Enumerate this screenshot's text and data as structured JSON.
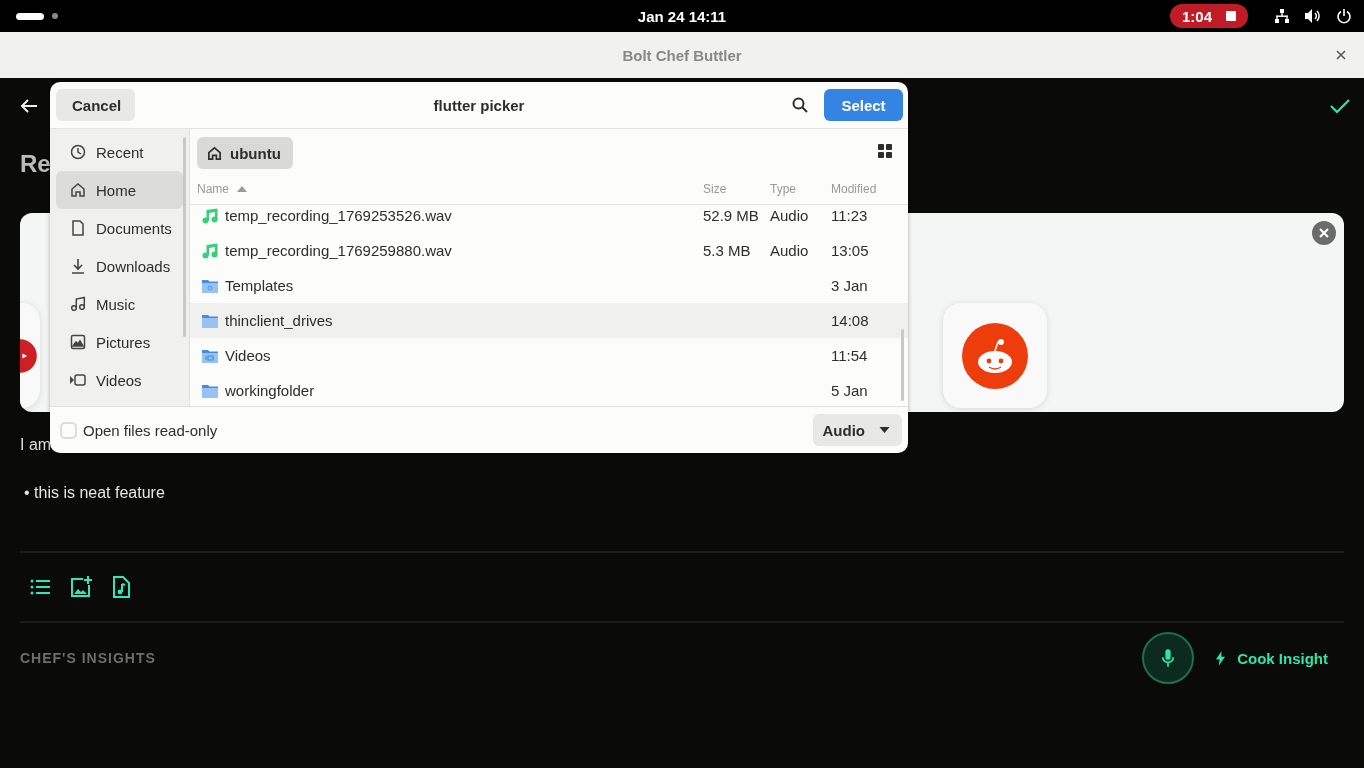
{
  "top_bar": {
    "clock": "Jan 24  14:11",
    "recording": "1:04"
  },
  "app": {
    "title": "Bolt Chef Buttler",
    "heading": "Re",
    "body_text": "I am",
    "bullet": "• this is neat feature",
    "section_title": "CHEF'S INSIGHTS",
    "insight_button": "Cook Insight"
  },
  "dialog": {
    "cancel": "Cancel",
    "title": "flutter picker",
    "select": "Select",
    "path": "ubuntu",
    "sidebar": [
      {
        "label": "Recent",
        "kind": "recent",
        "selected": false
      },
      {
        "label": "Home",
        "kind": "home",
        "selected": true
      },
      {
        "label": "Documents",
        "kind": "documents",
        "selected": false
      },
      {
        "label": "Downloads",
        "kind": "downloads",
        "selected": false
      },
      {
        "label": "Music",
        "kind": "music",
        "selected": false
      },
      {
        "label": "Pictures",
        "kind": "pictures",
        "selected": false
      },
      {
        "label": "Videos",
        "kind": "videos",
        "selected": false
      }
    ],
    "columns": [
      "Name",
      "Size",
      "Type",
      "Modified"
    ],
    "rows": [
      {
        "name": "temp_recording_1769253526.wav",
        "kind": "audio",
        "size": "52.9 MB",
        "type": "Audio",
        "modified": "11:23",
        "highlighted": false
      },
      {
        "name": "temp_recording_1769259880.wav",
        "kind": "audio",
        "size": "5.3 MB",
        "type": "Audio",
        "modified": "13:05",
        "highlighted": false
      },
      {
        "name": "Templates",
        "kind": "templates",
        "modified": "3 Jan",
        "highlighted": false
      },
      {
        "name": "thinclient_drives",
        "kind": "folder",
        "modified": "14:08",
        "highlighted": true
      },
      {
        "name": "Videos",
        "kind": "videos",
        "modified": "11:54",
        "highlighted": false
      },
      {
        "name": "workingfolder",
        "kind": "folder",
        "modified": "5 Jan",
        "highlighted": false
      }
    ],
    "read_only": {
      "label": "Open files read-only",
      "checked": false
    },
    "filter": "Audio"
  }
}
